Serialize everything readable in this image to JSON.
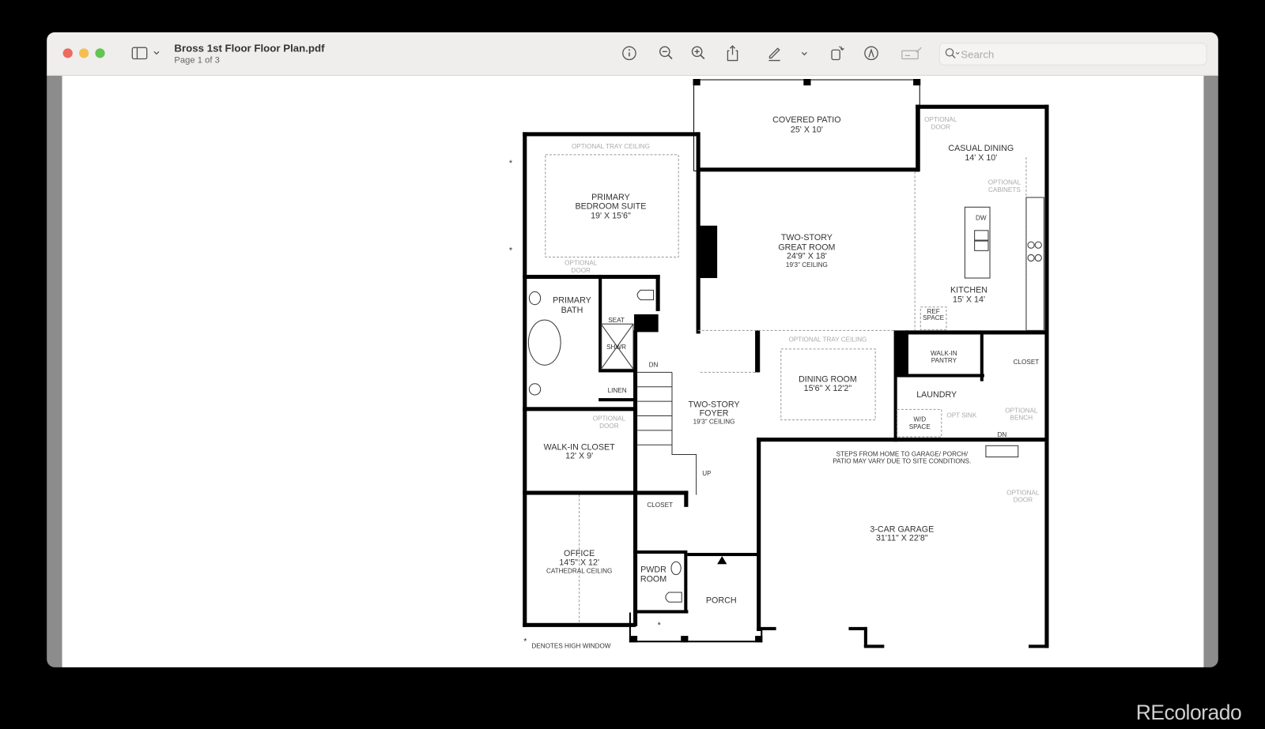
{
  "window": {
    "title": "Bross 1st Floor Floor Plan.pdf",
    "subtitle": "Page 1 of 3"
  },
  "toolbar": {
    "icons": [
      "sidebar-icon",
      "info-icon",
      "zoom-out-icon",
      "zoom-in-icon",
      "share-icon",
      "markup-pen-icon",
      "rotate-icon",
      "annotate-icon",
      "signature-icon",
      "search-icon"
    ],
    "search_placeholder": "Search"
  },
  "plan": {
    "covered_patio": [
      "COVERED PATIO",
      "25' X 10'"
    ],
    "casual_dining": [
      "CASUAL DINING",
      "14' X 10'"
    ],
    "optional_door_1": [
      "OPTIONAL",
      "DOOR"
    ],
    "optional_cabinets": [
      "OPTIONAL",
      "CABINETS"
    ],
    "dw": "DW",
    "kitchen": [
      "KITCHEN",
      "15' X 14'"
    ],
    "ref_space": [
      "REF",
      "SPACE"
    ],
    "tray_1": "OPTIONAL TRAY CEILING",
    "bedroom": [
      "PRIMARY",
      "BEDROOM SUITE",
      "19' X 15'6\""
    ],
    "optional_door_2": [
      "OPTIONAL",
      "DOOR"
    ],
    "bath": [
      "PRIMARY",
      "BATH"
    ],
    "seat": "SEAT",
    "shwr": "SHWR",
    "linen": "LINEN",
    "dn_1": "DN",
    "great_room": [
      "TWO-STORY",
      "GREAT ROOM",
      "24'9\" X 18'",
      "19'3\" CEILING"
    ],
    "tray_2": "OPTIONAL TRAY CEILING",
    "dining": [
      "DINING ROOM",
      "15'6\" X 12'2\""
    ],
    "pantry": [
      "WALK-IN",
      "PANTRY"
    ],
    "closet_1": "CLOSET",
    "laundry": "LAUNDRY",
    "wd": [
      "W/D",
      "SPACE"
    ],
    "opt_sink": "OPT SINK",
    "bench": [
      "OPTIONAL",
      "BENCH"
    ],
    "dn_2": "DN",
    "steps_note": [
      "STEPS FROM HOME TO GARAGE/ PORCH/",
      "PATIO MAY VARY DUE TO SITE CONDITIONS."
    ],
    "optional_door_3": [
      "OPTIONAL",
      "DOOR"
    ],
    "garage": [
      "3-CAR GARAGE",
      "31'11\" X 22'8\""
    ],
    "foyer": [
      "TWO-STORY",
      "FOYER",
      "19'3\" CEILING"
    ],
    "up": "UP",
    "optional_door_4": [
      "OPTIONAL",
      "DOOR"
    ],
    "walkin_closet": [
      "WALK-IN CLOSET",
      "12' X 9'"
    ],
    "closet_2": "CLOSET",
    "office": [
      "OFFICE",
      "14'5\" X 12'",
      "CATHEDRAL CEILING"
    ],
    "pwdr": [
      "PWDR",
      "ROOM"
    ],
    "porch": "PORCH",
    "asterisk": "*",
    "legend": "DENOTES HIGH WINDOW"
  },
  "watermark": "REcolorado",
  "colors": {
    "close": "#ed6a5e",
    "minimize": "#f5bf4f",
    "zoom": "#61c554",
    "wall": "#000000",
    "optional": "#aaaaaa"
  }
}
